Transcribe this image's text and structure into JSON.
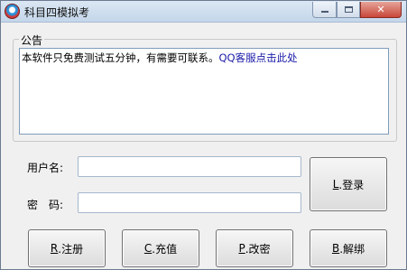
{
  "window": {
    "title": "科目四模拟考",
    "controls": {
      "minimize": "",
      "maximize": "",
      "close": "✕"
    }
  },
  "notice": {
    "group_label": "公告",
    "text": "本软件只免费测试五分钟，有需要可联系。",
    "link_text": "QQ客服点击此处"
  },
  "form": {
    "username_label": "用户名:",
    "username_value": "",
    "password_label": "密　码:",
    "password_value": ""
  },
  "buttons": {
    "login": {
      "key": "L",
      "label": ".登录"
    },
    "register": {
      "key": "R",
      "label": ".注册"
    },
    "recharge": {
      "key": "C",
      "label": ".充值"
    },
    "change_password": {
      "key": "P",
      "label": ".改密"
    },
    "unbind": {
      "key": "B",
      "label": ".解绑"
    }
  },
  "colors": {
    "link": "#1a1aa8",
    "titlebar": "#c4d6ea",
    "close_button": "#c9473a"
  }
}
